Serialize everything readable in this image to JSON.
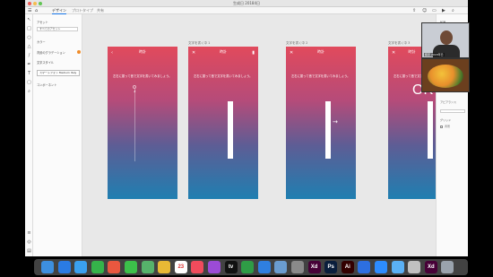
{
  "window": {
    "doc_title": "生成日 20184日",
    "tabs": [
      "デザイン",
      "プロトタイプ",
      "共有"
    ],
    "active_tab": 0
  },
  "layers_panel": {
    "header": "アセット",
    "search_placeholder": "すべてのアセット",
    "section_colors": "カラー",
    "section_char_styles": "文字スタイル",
    "section_components": "コンポーネント",
    "selected_item": "スマートフォン Medium Italy",
    "group_label": "背景のグラデーション"
  },
  "artboards": [
    {
      "label": "",
      "header_title": "時計",
      "message": "左右に振って音で文字を書いてみましょう。",
      "bar": false,
      "arrow": false,
      "ok_text": ""
    },
    {
      "label": "文字を書く中 1",
      "header_title": "時計",
      "message": "左右に振って音で文字を書いてみましょう。",
      "bar": true,
      "arrow": false,
      "ok_text": ""
    },
    {
      "label": "文字を書く中 2",
      "header_title": "時計",
      "message": "左右に振って音で文字を書いてみましょう。",
      "bar": true,
      "arrow": true,
      "ok_text": ""
    },
    {
      "label": "文字を書く中 3",
      "header_title": "時計",
      "message": "左右に振って音で文字を書いてみましょう。",
      "bar": true,
      "arrow": false,
      "ok_text": "OK"
    }
  ],
  "inspector": {
    "section_appearance": "アピアランス",
    "section_grid": "グリッド",
    "checkbox_label": "背景"
  },
  "video": {
    "participant_name": "藤原 2018年日"
  },
  "dock": {
    "apps": [
      {
        "name": "finder-icon",
        "label": "",
        "color": "#3d8fe0"
      },
      {
        "name": "safari-icon",
        "label": "",
        "color": "#2a7be4"
      },
      {
        "name": "mail-icon",
        "label": "",
        "color": "#3aa0f0"
      },
      {
        "name": "facetime-icon",
        "label": "",
        "color": "#35b34a"
      },
      {
        "name": "photos-icon",
        "label": "",
        "color": "#e9573f"
      },
      {
        "name": "messages-icon",
        "label": "",
        "color": "#3cc04a"
      },
      {
        "name": "maps-icon",
        "label": "",
        "color": "#56b26b"
      },
      {
        "name": "chrome-icon",
        "label": "",
        "color": "#e8b935"
      },
      {
        "name": "calendar-icon",
        "label": "23",
        "color": "#ffffff"
      },
      {
        "name": "music-icon",
        "label": "",
        "color": "#f04b5c"
      },
      {
        "name": "podcasts-icon",
        "label": "",
        "color": "#9b4bd6"
      },
      {
        "name": "tv-icon",
        "label": "tv",
        "color": "#111111"
      },
      {
        "name": "numbers-icon",
        "label": "",
        "color": "#2f9c46"
      },
      {
        "name": "keynote-icon",
        "label": "",
        "color": "#2f7fe0"
      },
      {
        "name": "preview-icon",
        "label": "",
        "color": "#6a9cd0"
      },
      {
        "name": "system-prefs-icon",
        "label": "",
        "color": "#8a8a8a"
      },
      {
        "name": "xd-icon",
        "label": "Xd",
        "color": "#470137"
      },
      {
        "name": "photoshop-icon",
        "label": "Ps",
        "color": "#0a1e3c"
      },
      {
        "name": "illustrator-icon",
        "label": "Ai",
        "color": "#330000"
      },
      {
        "name": "dropbox-icon",
        "label": "",
        "color": "#2d6fe0"
      },
      {
        "name": "zoom-icon",
        "label": "",
        "color": "#2d8cff"
      },
      {
        "name": "finder2-icon",
        "label": "",
        "color": "#5ab0f5"
      },
      {
        "name": "acrobat-icon",
        "label": "",
        "color": "#c0c0c0"
      },
      {
        "name": "xd2-icon",
        "label": "Xd",
        "color": "#470137"
      },
      {
        "name": "trash-icon",
        "label": "",
        "color": "#9aa3ad"
      }
    ]
  }
}
